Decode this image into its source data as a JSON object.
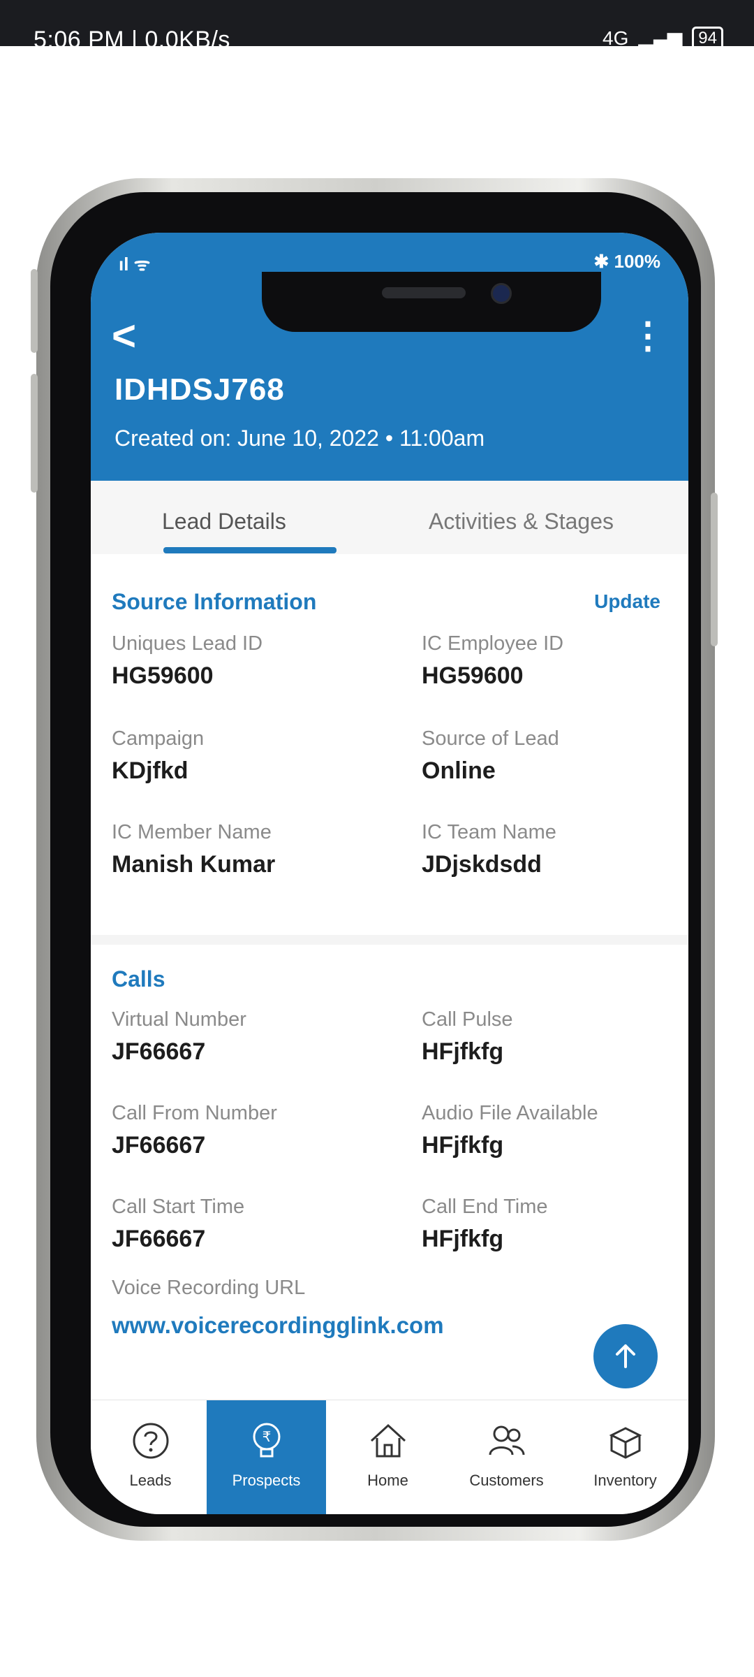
{
  "system_status": {
    "time_speed": "5:06 PM | 0.0KB/s",
    "signal": "4G",
    "battery": "94"
  },
  "phone_status": {
    "battery": "100%"
  },
  "header": {
    "back_label": "<",
    "title": "IDHDSJ768",
    "created": "Created on: June 10, 2022  •  11:00am"
  },
  "tabs": [
    "Lead Details",
    "Activities & Stages"
  ],
  "source": {
    "title": "Source Information",
    "update": "Update",
    "fields": [
      {
        "label": "Uniques Lead ID",
        "value": "HG59600"
      },
      {
        "label": "IC Employee ID",
        "value": "HG59600"
      },
      {
        "label": "Campaign",
        "value": "KDjfkd"
      },
      {
        "label": "Source of Lead",
        "value": "Online"
      },
      {
        "label": "IC Member Name",
        "value": "Manish Kumar"
      },
      {
        "label": "IC Team Name",
        "value": "JDjskdsdd"
      }
    ]
  },
  "calls": {
    "title": "Calls",
    "fields": [
      {
        "label": "Virtual Number",
        "value": "JF66667"
      },
      {
        "label": "Call Pulse",
        "value": "HFjfkfg"
      },
      {
        "label": "Call From Number",
        "value": "JF66667"
      },
      {
        "label": "Audio File Available",
        "value": "HFjfkfg"
      },
      {
        "label": "Call Start Time",
        "value": "JF66667"
      },
      {
        "label": "Call End Time",
        "value": "HFjfkfg"
      }
    ],
    "voice_label": "Voice Recording URL",
    "voice_url": "www.voicerecordingglink.com"
  },
  "bottom_nav": [
    "Leads",
    "Prospects",
    "Home",
    "Customers",
    "Inventory"
  ],
  "colors": {
    "primary": "#1f7abd",
    "text": "#1d1d1d",
    "muted": "#8a8a8a"
  }
}
